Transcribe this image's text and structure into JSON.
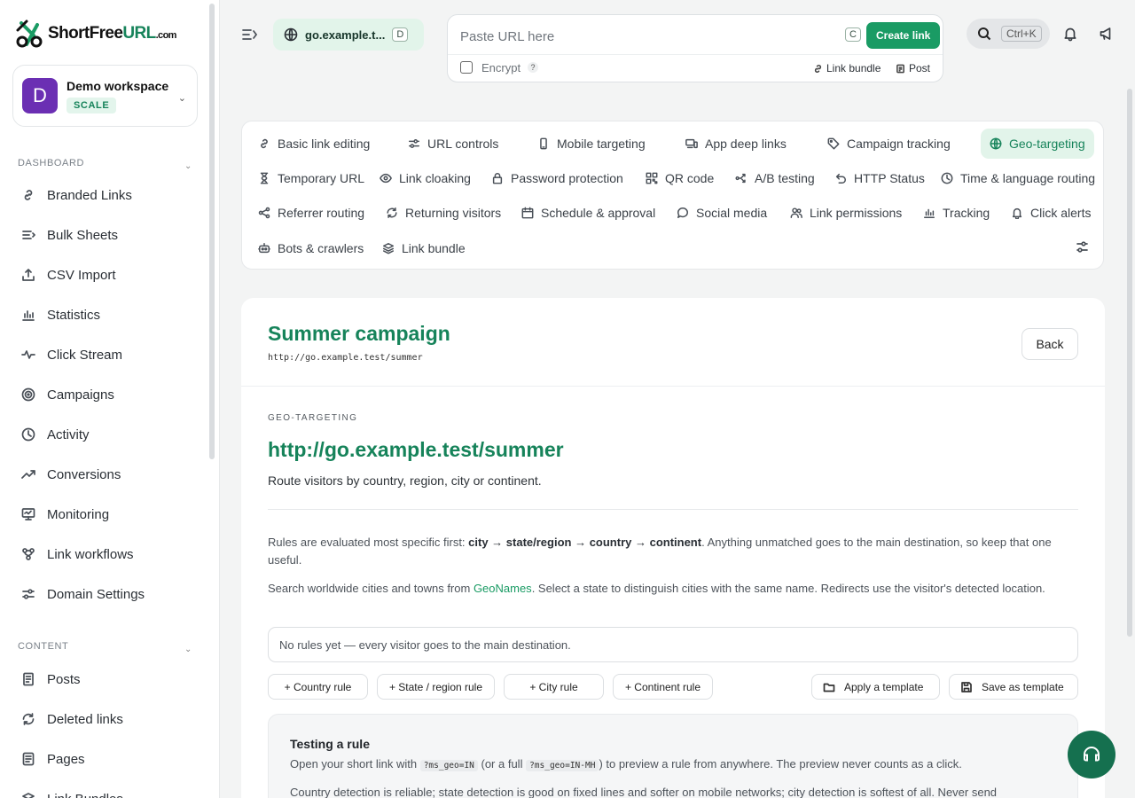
{
  "brand": {
    "name_prefix": "ShortFree",
    "name_accent": "URL",
    "name_suffix": ".com"
  },
  "workspace": {
    "initial": "D",
    "name": "Demo workspace",
    "plan": "SCALE"
  },
  "sidebar": {
    "dashboard_title": "DASHBOARD",
    "dashboard_items": [
      {
        "label": "Branded Links",
        "icon": "link-icon"
      },
      {
        "label": "Bulk Sheets",
        "icon": "list-icon"
      },
      {
        "label": "CSV Import",
        "icon": "upload-icon"
      },
      {
        "label": "Statistics",
        "icon": "bar-chart-icon"
      },
      {
        "label": "Click Stream",
        "icon": "pulse-icon"
      },
      {
        "label": "Campaigns",
        "icon": "target-icon"
      },
      {
        "label": "Activity",
        "icon": "clock-icon"
      },
      {
        "label": "Conversions",
        "icon": "trend-icon"
      },
      {
        "label": "Monitoring",
        "icon": "monitor-icon"
      },
      {
        "label": "Link workflows",
        "icon": "workflow-icon"
      },
      {
        "label": "Domain Settings",
        "icon": "sliders-icon"
      }
    ],
    "content_title": "CONTENT",
    "content_items": [
      {
        "label": "Posts",
        "icon": "document-icon"
      },
      {
        "label": "Deleted links",
        "icon": "refresh-icon"
      },
      {
        "label": "Pages",
        "icon": "page-icon"
      },
      {
        "label": "Link Bundles",
        "icon": "layers-icon"
      }
    ]
  },
  "topbar": {
    "domain": "go.example.t...",
    "domain_key": "D",
    "url_placeholder": "Paste URL here",
    "url_key": "C",
    "create_label": "Create link",
    "encrypt_label": "Encrypt",
    "encrypt_help": "?",
    "link_bundle_label": "Link bundle",
    "post_label": "Post",
    "search_shortcut": "Ctrl+K"
  },
  "feature_tabs": [
    {
      "label": "Basic link editing",
      "icon": "link-icon"
    },
    {
      "label": "URL controls",
      "icon": "sliders-icon"
    },
    {
      "label": "Mobile targeting",
      "icon": "phone-icon"
    },
    {
      "label": "App deep links",
      "icon": "devices-icon"
    },
    {
      "label": "Campaign tracking",
      "icon": "tag-icon"
    },
    {
      "label": "Geo-targeting",
      "icon": "globe-icon",
      "active": true
    },
    {
      "label": "Temporary URL",
      "icon": "hourglass-icon"
    },
    {
      "label": "Link cloaking",
      "icon": "eye-icon"
    },
    {
      "label": "Password protection",
      "icon": "lock-icon"
    },
    {
      "label": "QR code",
      "icon": "qr-icon"
    },
    {
      "label": "A/B testing",
      "icon": "split-icon"
    },
    {
      "label": "HTTP Status",
      "icon": "undo-icon"
    },
    {
      "label": "Time & language routing",
      "icon": "clock-icon"
    },
    {
      "label": "Referrer routing",
      "icon": "share-icon"
    },
    {
      "label": "Returning visitors",
      "icon": "refresh-icon"
    },
    {
      "label": "Schedule & approval",
      "icon": "calendar-icon"
    },
    {
      "label": "Social media",
      "icon": "chat-icon"
    },
    {
      "label": "Link permissions",
      "icon": "users-icon"
    },
    {
      "label": "Tracking",
      "icon": "bar-chart-icon"
    },
    {
      "label": "Click alerts",
      "icon": "bell-icon"
    },
    {
      "label": "Bots & crawlers",
      "icon": "robot-icon"
    },
    {
      "label": "Link bundle",
      "icon": "layers-icon"
    }
  ],
  "main": {
    "title": "Summer campaign",
    "short_url": "http://go.example.test/summer",
    "back_label": "Back",
    "kicker": "GEO-TARGETING",
    "section_title": "http://go.example.test/summer",
    "section_desc": "Route visitors by country, region, city or continent.",
    "rules_intro_1": "Rules are evaluated most specific first: ",
    "rules_order": "city → state/region → country → continent",
    "rules_intro_2": ". Anything unmatched goes to the main destination, so keep that one useful.",
    "search_intro_1": "Search worldwide cities and towns from ",
    "search_link": "GeoNames",
    "search_intro_2": ". Select a state to distinguish cities with the same name. Redirects use the visitor's detected location.",
    "empty_state": "No rules yet — every visitor goes to the main destination.",
    "add_country": "+ Country rule",
    "add_state": "+ State / region rule",
    "add_city": "+ City rule",
    "add_continent": "+ Continent rule",
    "apply_template": "Apply a template",
    "save_template": "Save as template",
    "testing_title": "Testing a rule",
    "testing_1a": "Open your short link with ",
    "testing_code1": "?ms_geo=IN",
    "testing_1b": " (or a full ",
    "testing_code2": "?ms_geo=IN-MH",
    "testing_1c": ") to preview a rule from anywhere. The preview never counts as a click.",
    "testing_2": "Country detection is reliable; state detection is good on fixed lines and softer on mobile networks; city detection is softest of all. Never send"
  },
  "colors": {
    "brand_green": "#16835a",
    "button_green": "#1a9b64",
    "avatar_purple": "#6b2fb3"
  }
}
